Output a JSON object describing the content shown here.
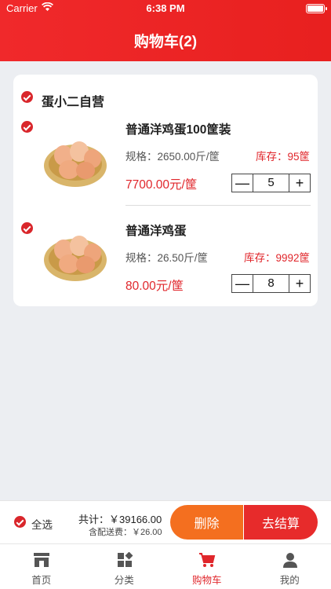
{
  "status_bar": {
    "carrier": "Carrier",
    "time": "6:38 PM"
  },
  "header": {
    "title": "购物车(2)"
  },
  "store": {
    "name": "蛋小二自营"
  },
  "items": [
    {
      "title": "普通洋鸡蛋100筐装",
      "spec": "规格：2650.00斤/筐",
      "stock": "库存：95筐",
      "price": "7700.00元/筐",
      "quantity": "5",
      "minus": "—",
      "plus": "+"
    },
    {
      "title": "普通洋鸡蛋",
      "spec": "规格：26.50斤/筐",
      "stock": "库存：9992筐",
      "price": "80.00元/筐",
      "quantity": "8",
      "minus": "—",
      "plus": "+"
    }
  ],
  "footer": {
    "select_all": "全选",
    "total": "共计：￥39166.00",
    "shipping": "含配送费：￥26.00",
    "delete": "删除",
    "checkout": "去结算"
  },
  "tabs": [
    {
      "label": "首页",
      "icon": "store-icon"
    },
    {
      "label": "分类",
      "icon": "category-icon"
    },
    {
      "label": "购物车",
      "icon": "cart-icon"
    },
    {
      "label": "我的",
      "icon": "user-icon"
    }
  ],
  "colors": {
    "primary": "#e8201f",
    "price": "#e0262b",
    "delete": "#f46f1f"
  }
}
